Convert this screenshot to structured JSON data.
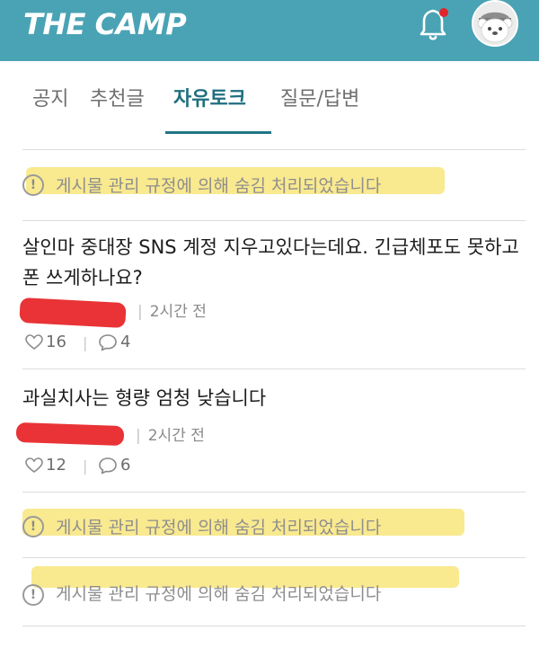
{
  "header": {
    "logo_text": "THE CAMP",
    "bell_icon": "bell-icon",
    "notification_dot_color": "#e0262b",
    "avatar_icon": "bear-avatar-icon",
    "background_color": "#4aa3b4"
  },
  "tabs": [
    {
      "label": "공지",
      "active": false
    },
    {
      "label": "추천글",
      "active": false
    },
    {
      "label": "자유토크",
      "active": true
    },
    {
      "label": "질문/답변",
      "active": false
    }
  ],
  "feed": {
    "hidden_notice_text": "게시물 관리 규정에 의해 숨김 처리되었습니다",
    "hidden_notice_icon": "exclamation-circle-icon",
    "posts": [
      {
        "title": "살인마 중대장 SNS 계정 지우고있다는데요. 긴급체포도 못하고 폰 쓰게하나요?",
        "time": "2시간 전",
        "likes": "16",
        "comments": "4"
      },
      {
        "title": "과실치사는 형량 엄청 낮습니다",
        "time": "2시간 전",
        "likes": "12",
        "comments": "6"
      }
    ]
  },
  "colors": {
    "accent": "#1f6f7e",
    "highlight": "#f7e16a",
    "redaction": "#e8282b"
  }
}
